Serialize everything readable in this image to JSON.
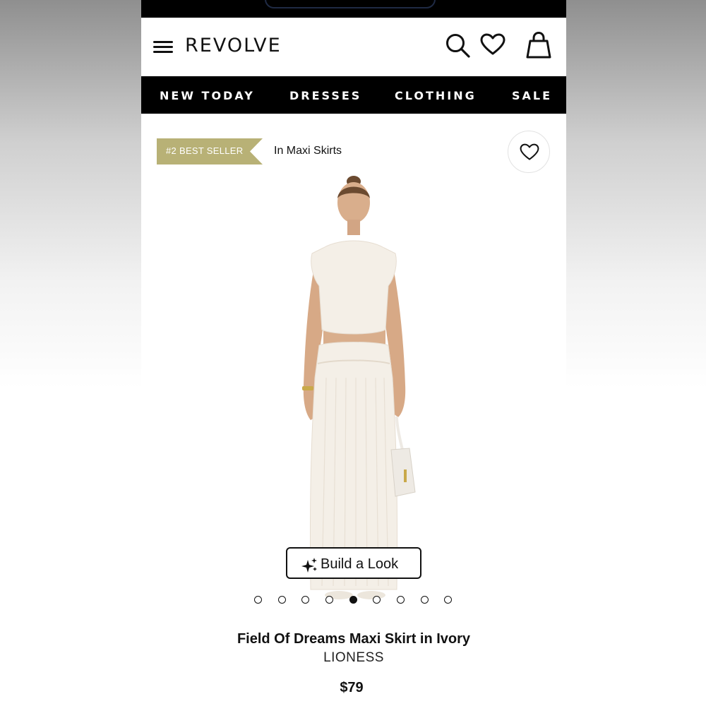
{
  "header": {
    "logo": "REVOLVE",
    "menu_icon": "hamburger-menu-icon",
    "search_icon": "search-icon",
    "wishlist_icon": "heart-icon",
    "bag_icon": "shopping-bag-icon"
  },
  "nav": {
    "items": [
      {
        "label": "NEW TODAY"
      },
      {
        "label": "DRESSES"
      },
      {
        "label": "CLOTHING"
      },
      {
        "label": "SALE"
      }
    ]
  },
  "badge": {
    "label": "#2 BEST SELLER",
    "category": "In Maxi Skirts",
    "color": "#b8b176"
  },
  "product": {
    "image": "model-wearing-ivory-crop-top-and-maxi-skirt",
    "build_look_label": "Build a Look",
    "build_look_icon": "sparkles-icon",
    "carousel": {
      "count": 9,
      "active_index": 4
    },
    "title": "Field Of Dreams Maxi Skirt in Ivory",
    "brand": "LIONESS",
    "price": "$79"
  },
  "colors": {
    "nav_background": "#000000",
    "badge_background": "#b8b176",
    "product_ivory": "#f4efe7"
  }
}
